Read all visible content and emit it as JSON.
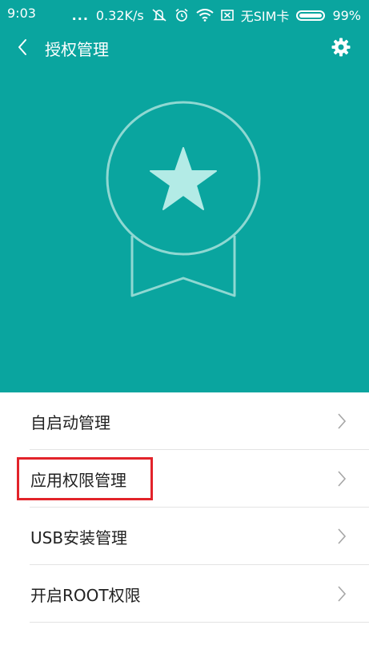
{
  "status_bar": {
    "time": "9:03",
    "network_speed": "0.32K/s",
    "sim_status": "无SIM卡",
    "battery": "99%",
    "dots": "...",
    "icons": [
      "mute-icon",
      "alarm-icon",
      "wifi-icon",
      "no-sim-icon",
      "battery-icon"
    ]
  },
  "header": {
    "title": "授权管理",
    "back_icon": "back-chevron-icon",
    "settings_icon": "gear-icon"
  },
  "hero": {
    "icon": "medal-star-icon",
    "color": "#0aa59f"
  },
  "menu": {
    "items": [
      {
        "label": "自启动管理"
      },
      {
        "label": "应用权限管理",
        "highlighted": true
      },
      {
        "label": "USB安装管理"
      },
      {
        "label": "开启ROOT权限"
      }
    ]
  },
  "colors": {
    "accent": "#0aa59f",
    "highlight_border": "#e2232a"
  }
}
